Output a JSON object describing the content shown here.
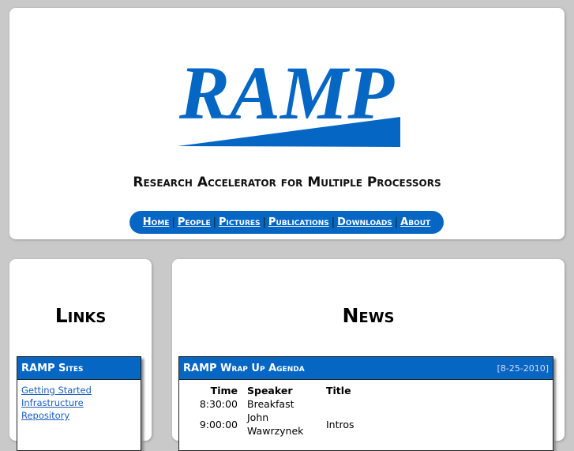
{
  "header": {
    "logo_text": "RAMP",
    "tagline": "Research Accelerator for Multiple Processors",
    "nav": [
      "Home",
      "People",
      "Pictures",
      "Publications",
      "Downloads",
      "About"
    ],
    "nav_separator": "|"
  },
  "left": {
    "title": "Links",
    "box_title": "RAMP Sites",
    "links": [
      "Getting Started",
      "Infrastructure",
      "Repository"
    ]
  },
  "right": {
    "title": "News",
    "item_title": "RAMP Wrap Up Agenda",
    "item_date": "[8-25-2010]",
    "columns": [
      "Time",
      "Speaker",
      "Title"
    ],
    "rows": [
      {
        "time": "8:30:00",
        "speaker": "Breakfast",
        "title": ""
      },
      {
        "time": "9:00:00",
        "speaker": "John Wawrzynek",
        "title": "Intros"
      }
    ]
  },
  "colors": {
    "brand": "#0566c4"
  }
}
